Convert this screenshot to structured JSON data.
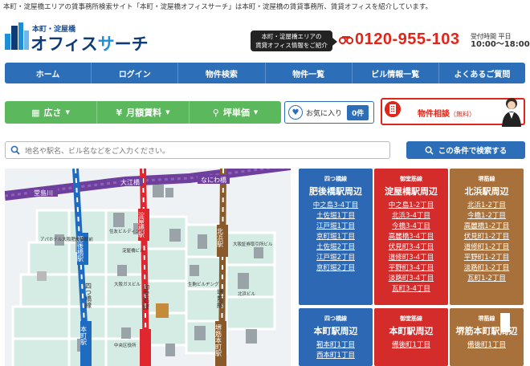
{
  "header": {
    "tagline": "本町・淀屋橋エリアの賃事務所検索サイト「本町・淀屋橋オフィスサーチ」は本町・淀屋橋の賃貸事務所、賃貸オフィスを紹介しています。",
    "logo_sub": "本町・淀屋橋",
    "logo_main_a": "オフィス",
    "logo_main_b": "サ",
    "logo_main_c": "ーチ",
    "callout_line1": "本町・淀屋橋エリアの",
    "callout_line2": "賃貸オフィス情報をご紹介",
    "phone": "0120-955-103",
    "hours_label": "受付時間 平日",
    "hours_time": "10:00～18:00"
  },
  "nav": {
    "items": [
      "ホーム",
      "ログイン",
      "物件検索",
      "物件一覧",
      "ビル情報一覧",
      "よくあるご質問"
    ]
  },
  "filters": {
    "size_label": "広さ",
    "rent_label": "月額賃料",
    "unit_label": "坪単価"
  },
  "favorites": {
    "label": "お気に入り",
    "count": "0件"
  },
  "consult": {
    "label": "物件相談",
    "note": "（無料）"
  },
  "search": {
    "placeholder": "地名や駅名、ビル名などをご入力ください。",
    "button_label": "この条件で検索する"
  },
  "map": {
    "labels": {
      "doujima": "堂島川",
      "ooe": "大江橋",
      "naniwa": "なにわ橋",
      "higobashi_st": "肥後橋駅",
      "yodoyabashi_st": "淀屋橋駅",
      "kitahama_st": "北浜駅",
      "yotsubashi_line": "四つ橋線",
      "midosuji_line": "御堂筋線",
      "sakaisuji_line": "堺筋線",
      "sakaisuji_hommachi": "堺筋本町駅",
      "hommachi_st": "本町駅",
      "bld_a": "アパホテル大阪肥後橋駅前",
      "bld_b": "住友ビルディング",
      "bld_c": "淀屋橋ビル",
      "bld_d": "大阪ガスビル",
      "bld_e": "生駒ビルヂング",
      "bld_f": "大阪証券取引所ビル",
      "bld_g": "北浜ビル",
      "bld_h": "中央区役所"
    },
    "colors": {
      "river": "#6f3f9e",
      "yotsubashi": "#1f6bc2",
      "midosuji": "#e0262e",
      "sakaisuji": "#8a5a2b",
      "road": "#cfd9df",
      "block": "#d4ece4"
    }
  },
  "areas": [
    {
      "line": "四つ橋線",
      "station": "肥後橋駅周辺",
      "streets": [
        "中之島3-4丁目",
        "土佐堀1丁目",
        "江戸堀1丁目",
        "京町堀1丁目",
        "土佐堀2丁目",
        "江戸堀2丁目",
        "京町堀2丁目"
      ]
    },
    {
      "line": "御堂筋線",
      "station": "淀屋橋駅周辺",
      "streets": [
        "中之島1-2丁目",
        "北浜3-4丁目",
        "今橋3-4丁目",
        "高麗橋3-4丁目",
        "伏見町3-4丁目",
        "道修町3-4丁目",
        "平野町3-4丁目",
        "淡路町3-4丁目",
        "瓦町3-4丁目"
      ]
    },
    {
      "line": "堺筋線",
      "station": "北浜駅周辺",
      "streets": [
        "北浜1-2丁目",
        "今橋1-2丁目",
        "高麗橋1-2丁目",
        "伏見町1-2丁目",
        "道修町1-2丁目",
        "平野町1-2丁目",
        "淡路町1-2丁目",
        "瓦町1-2丁目"
      ]
    },
    {
      "line": "四つ橋線",
      "station": "本町駅周辺",
      "streets": [
        "靭本町1丁目",
        "西本町1丁目"
      ]
    },
    {
      "line": "御堂筋線",
      "station": "本町駅周辺",
      "streets": [
        "備後町1丁目"
      ]
    },
    {
      "line": "堺筋線",
      "station": "堺筋本町駅周辺",
      "streets": [
        "備後町1丁目"
      ]
    }
  ]
}
